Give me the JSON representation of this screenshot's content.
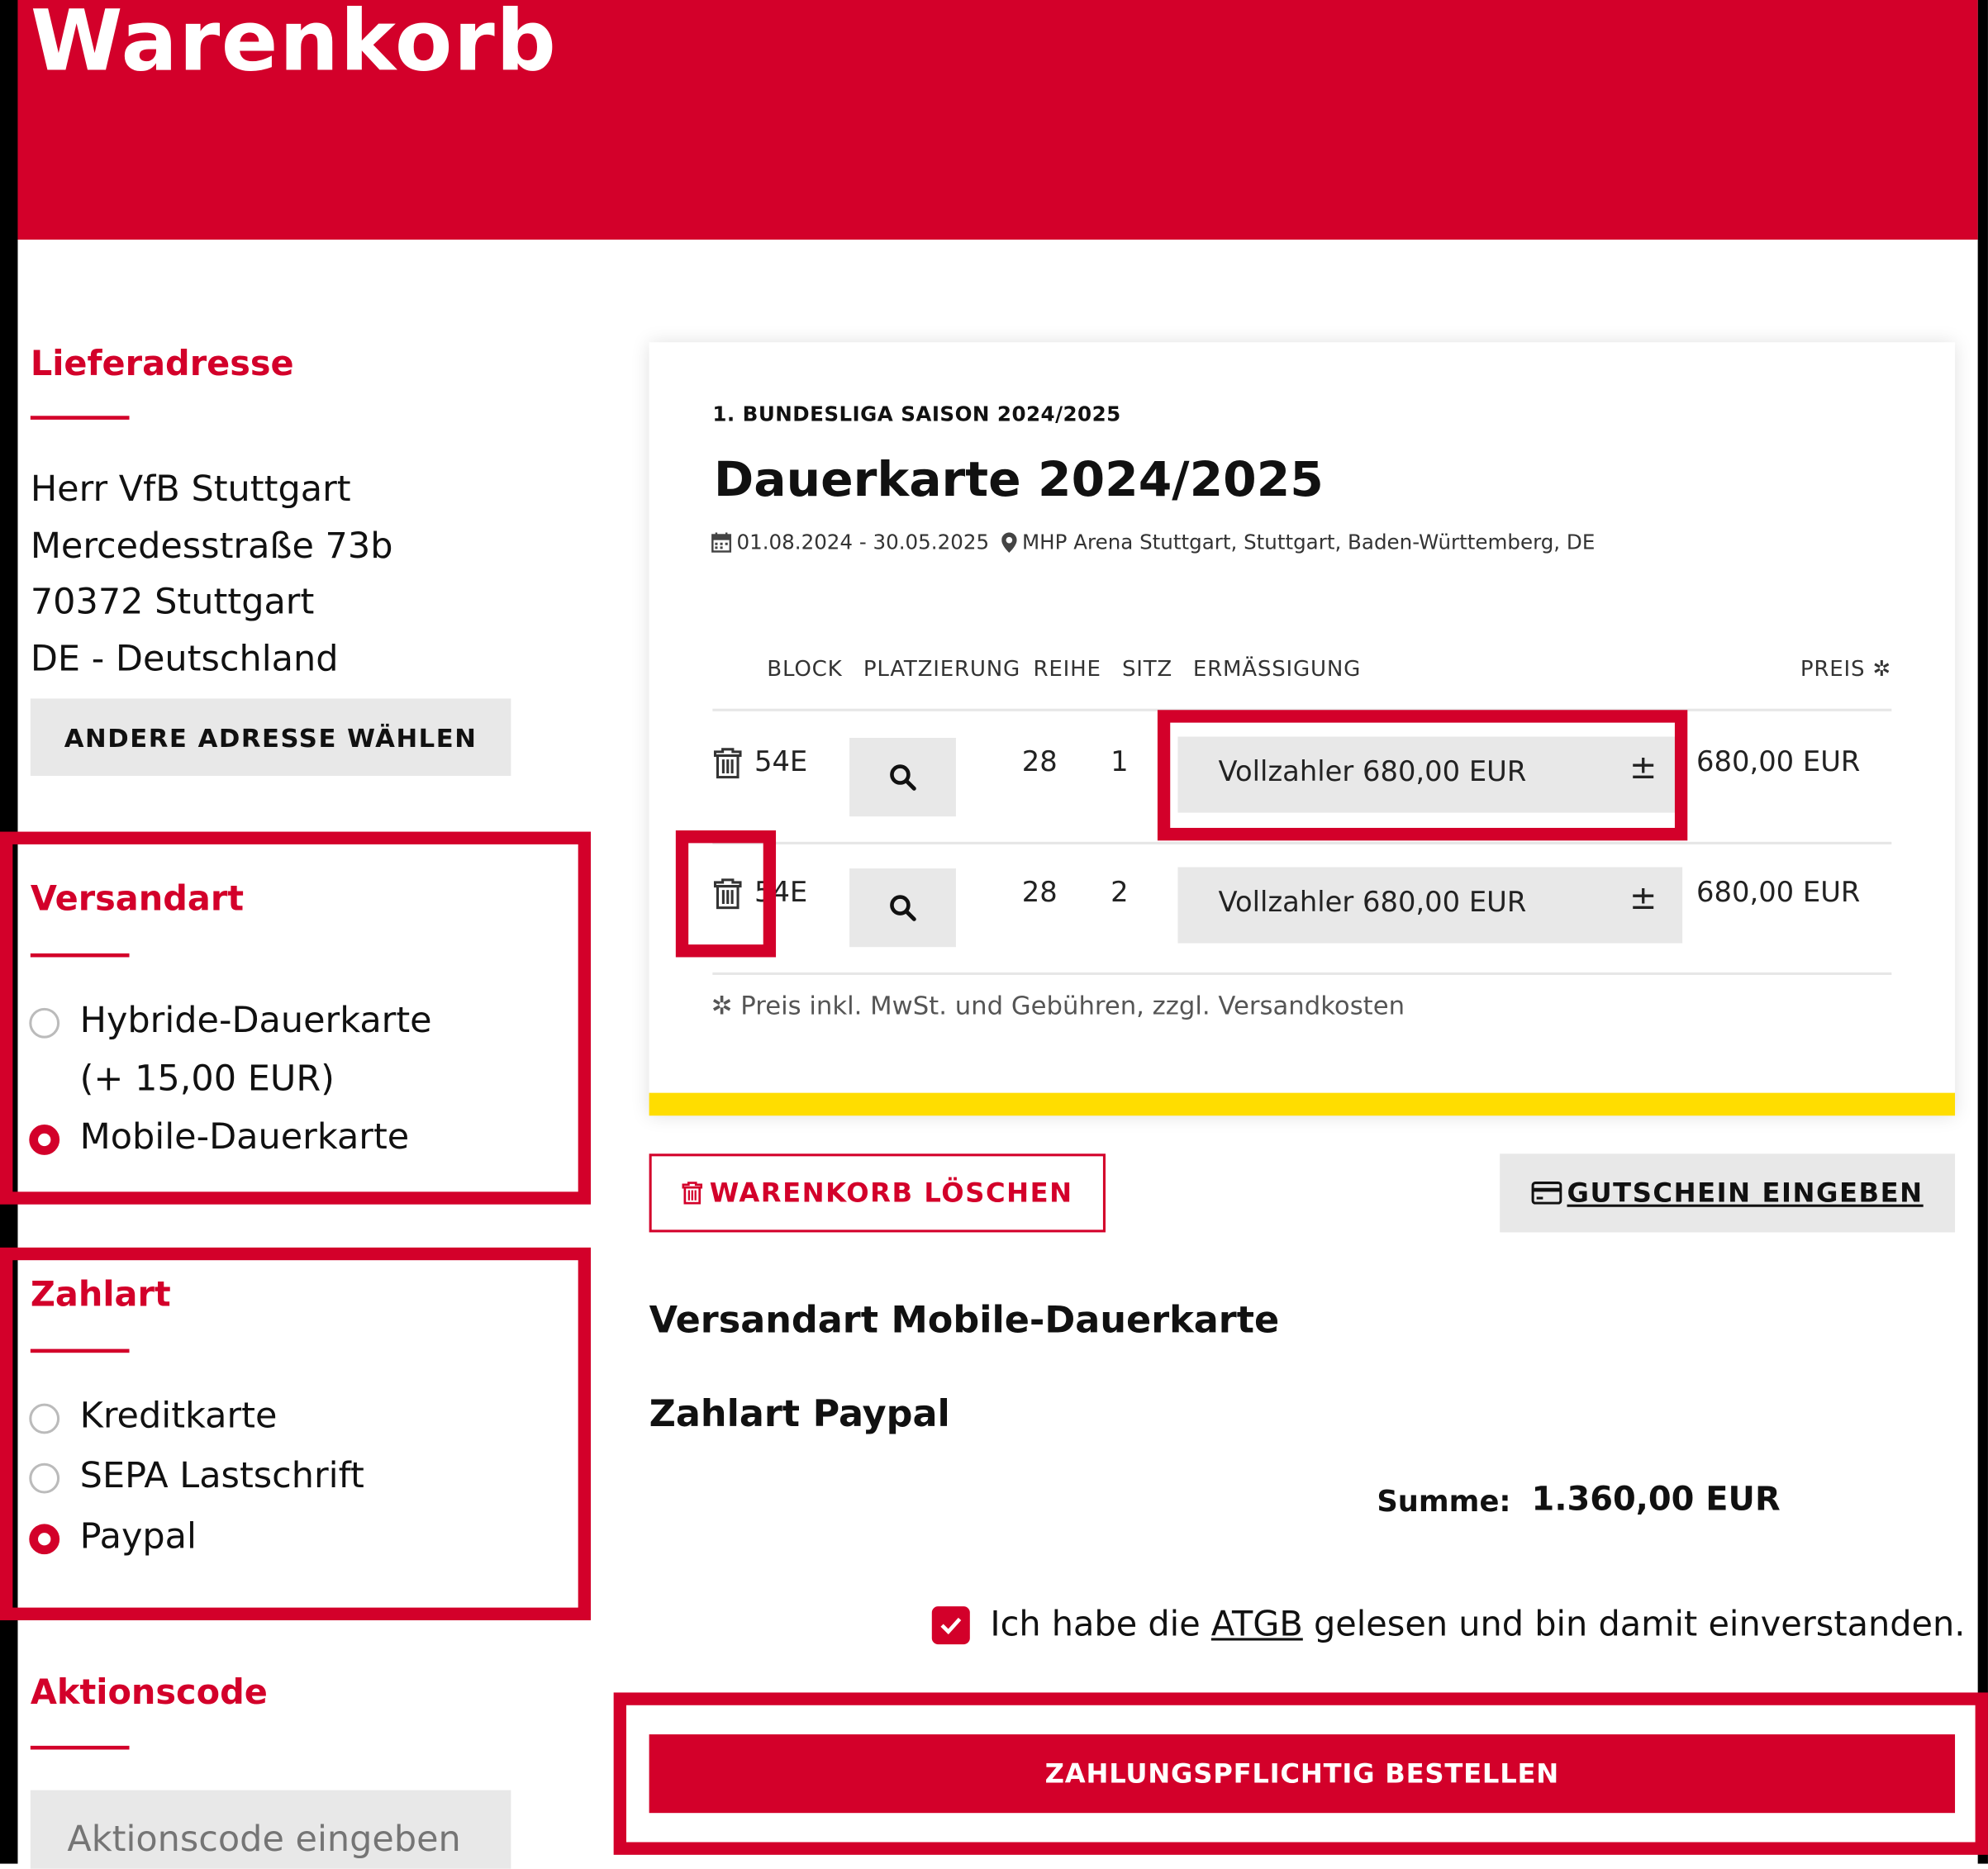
{
  "header": {
    "title": "Warenkorb"
  },
  "delivery": {
    "title": "Lieferadresse",
    "address_lines": [
      "Herr VfB Stuttgart",
      "Mercedesstraße 73b",
      "70372 Stuttgart",
      "DE - Deutschland"
    ],
    "change_button": "ANDERE ADRESSE WÄHLEN"
  },
  "shipping": {
    "title": "Versandart",
    "options": [
      {
        "label": "Hybride-Dauerkarte",
        "sublabel": "(+ 15,00 EUR)",
        "selected": false
      },
      {
        "label": "Mobile-Dauerkarte",
        "selected": true
      }
    ]
  },
  "payment": {
    "title": "Zahlart",
    "options": [
      {
        "label": "Kreditkarte",
        "selected": false
      },
      {
        "label": "SEPA Lastschrift",
        "selected": false
      },
      {
        "label": "Paypal",
        "selected": true
      }
    ]
  },
  "promo": {
    "title": "Aktionscode",
    "placeholder": "Aktionscode eingeben"
  },
  "ticket": {
    "league": "1. BUNDESLIGA SAISON 2024/2025",
    "name": "Dauerkarte 2024/2025",
    "date_range": "01.08.2024 - 30.05.2025",
    "venue": "MHP Arena Stuttgart, Stuttgart, Baden-Württemberg, DE",
    "columns": {
      "block": "BLOCK",
      "placement": "PLATZIERUNG",
      "row": "REIHE",
      "seat": "SITZ",
      "discount": "ERMÄSSIGUNG",
      "price": "PREIS"
    },
    "rows": [
      {
        "block": "54E",
        "row": "28",
        "seat": "1",
        "discount": "Vollzahler 680,00 EUR",
        "price": "680,00 EUR"
      },
      {
        "block": "54E",
        "row": "28",
        "seat": "2",
        "discount": "Vollzahler 680,00 EUR",
        "price": "680,00 EUR"
      }
    ],
    "footnote": "Preis inkl. MwSt. und Gebühren, zzgl. Versandkosten"
  },
  "actions": {
    "clear_cart": "WARENKORB LÖSCHEN",
    "voucher": "GUTSCHEIN EINGEBEN"
  },
  "summary": {
    "shipping_line": "Versandart Mobile-Dauerkarte",
    "payment_line": "Zahlart Paypal",
    "total_label": "Summe:",
    "total_value": "1.360,00 EUR"
  },
  "terms": {
    "prefix": "Ich habe die ",
    "link": "ATGB",
    "suffix": " gelesen und bin damit einverstanden.",
    "checked": true
  },
  "order_button": "ZAHLUNGSPFLICHTIG BESTELLEN",
  "colors": {
    "brand": "#d3002a",
    "accent": "#ffdd00"
  }
}
